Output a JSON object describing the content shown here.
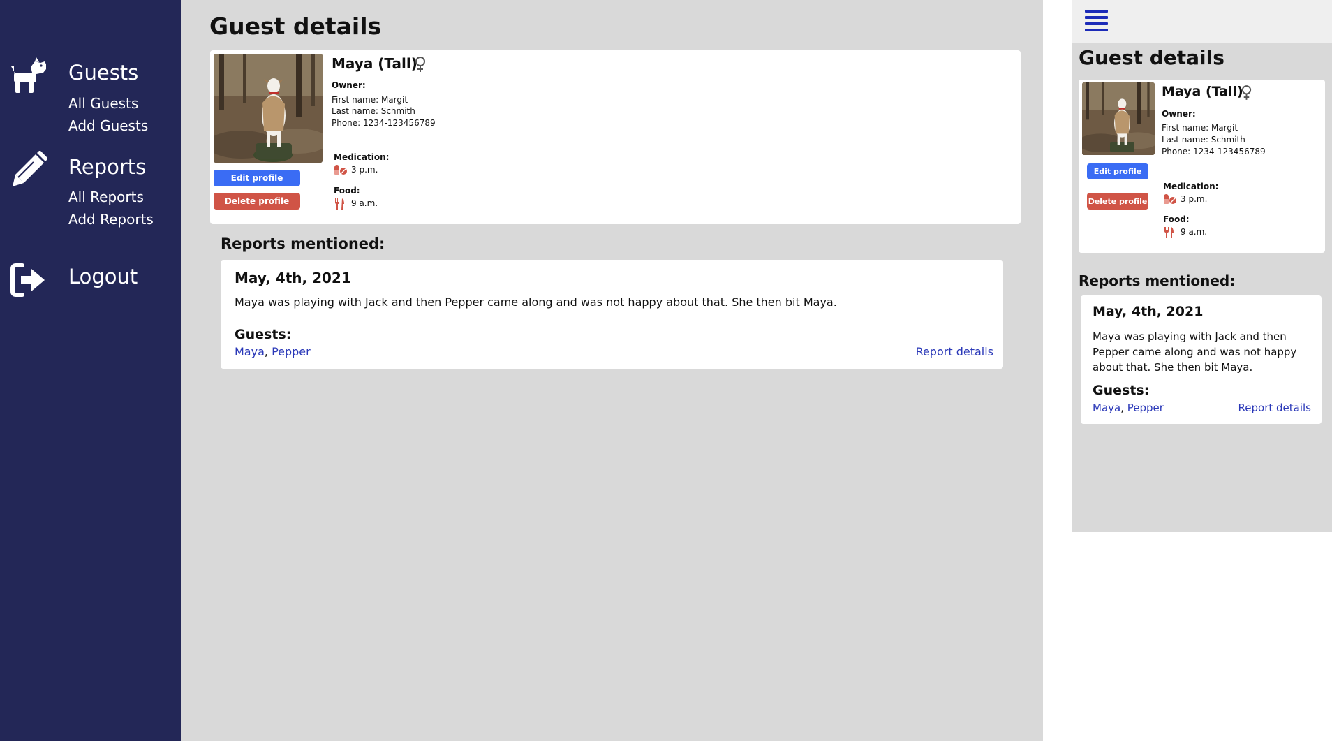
{
  "sidebar": {
    "guests": {
      "icon": "dog-icon",
      "title": "Guests",
      "items": [
        "All Guests",
        "Add Guests"
      ]
    },
    "reports": {
      "icon": "pencil-icon",
      "title": "Reports",
      "items": [
        "All Reports",
        "Add Reports"
      ]
    },
    "logout": {
      "icon": "logout-icon",
      "title": "Logout"
    }
  },
  "page": {
    "title": "Guest details"
  },
  "guest": {
    "name": "Maya (Tall)",
    "gender_icon": "female-symbol-icon",
    "photo_icon": "dog-photo",
    "owner_label": "Owner:",
    "first_name": "First name: Margit",
    "last_name": "Last name: Schmith",
    "phone": "Phone: 1234-123456789",
    "medication_label": "Medication:",
    "medication_icon": "pills-icon",
    "medication_time": "3 p.m.",
    "food_label": "Food:",
    "food_icon": "utensils-icon",
    "food_time": "9 a.m.",
    "edit_label": "Edit profile",
    "delete_label": "Delete profile"
  },
  "reports": {
    "section_title": "Reports mentioned:",
    "items": [
      {
        "date": "May, 4th, 2021",
        "text": "Maya was playing with Jack and then Pepper came along and was not happy about that. She then bit Maya.",
        "guests_label": "Guests:",
        "guests": [
          "Maya",
          "Pepper"
        ],
        "guest_separator": ", ",
        "details_link": "Report details"
      }
    ]
  },
  "mobile": {
    "menu_icon": "hamburger-icon"
  },
  "colors": {
    "sidebar_bg": "#232757",
    "main_bg": "#d9d9d9",
    "edit_button": "#3a6cf4",
    "delete_button": "#d05446",
    "link": "#2a38b8",
    "hamburger": "#1c2bb8",
    "icon_red": "#d05446"
  }
}
